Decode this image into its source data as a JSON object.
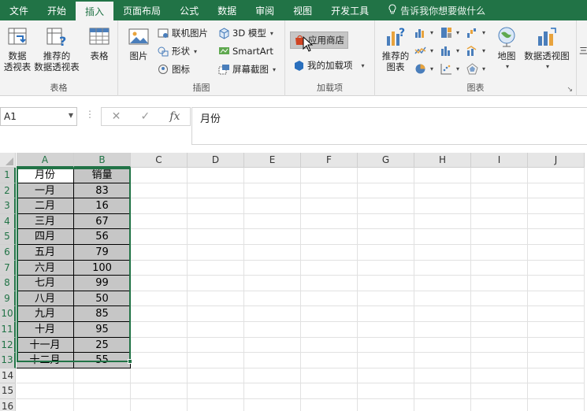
{
  "tabs": [
    "文件",
    "开始",
    "插入",
    "页面布局",
    "公式",
    "数据",
    "审阅",
    "视图",
    "开发工具"
  ],
  "active_tab": "插入",
  "tell_me": "告诉我你想要做什么",
  "ribbon": {
    "tables": {
      "label": "表格",
      "pivot": "数据\n透视表",
      "recommended_pivot": "推荐的\n数据透视表",
      "table": "表格"
    },
    "illustrations": {
      "label": "插图",
      "picture": "图片",
      "online_picture": "联机图片",
      "shapes": "形状",
      "icons": "图标",
      "model3d": "3D 模型",
      "smartart": "SmartArt",
      "screenshot": "屏幕截图"
    },
    "addins": {
      "label": "加载项",
      "store": "应用商店",
      "my_addins": "我的加载项"
    },
    "charts": {
      "label": "图表",
      "recommended": "推荐的\n图表",
      "maps": "地图",
      "pivot_chart": "数据透视图"
    }
  },
  "formula_bar": {
    "name_box": "A1",
    "cancel": "✕",
    "enter": "✓",
    "fx": "fx",
    "content": "月份"
  },
  "columns": [
    "A",
    "B",
    "C",
    "D",
    "E",
    "F",
    "G",
    "H",
    "I",
    "J"
  ],
  "rows": [
    "1",
    "2",
    "3",
    "4",
    "5",
    "6",
    "7",
    "8",
    "9",
    "10",
    "11",
    "12",
    "13",
    "14",
    "15",
    "16"
  ],
  "table": {
    "headers": [
      "月份",
      "销量"
    ],
    "rows": [
      [
        "一月",
        "83"
      ],
      [
        "二月",
        "16"
      ],
      [
        "三月",
        "67"
      ],
      [
        "四月",
        "56"
      ],
      [
        "五月",
        "79"
      ],
      [
        "六月",
        "100"
      ],
      [
        "七月",
        "99"
      ],
      [
        "八月",
        "50"
      ],
      [
        "九月",
        "85"
      ],
      [
        "十月",
        "95"
      ],
      [
        "十一月",
        "25"
      ],
      [
        "十二月",
        "55"
      ]
    ]
  },
  "colors": {
    "accent": "#217346",
    "selection_fill": "#c6c6c6"
  }
}
